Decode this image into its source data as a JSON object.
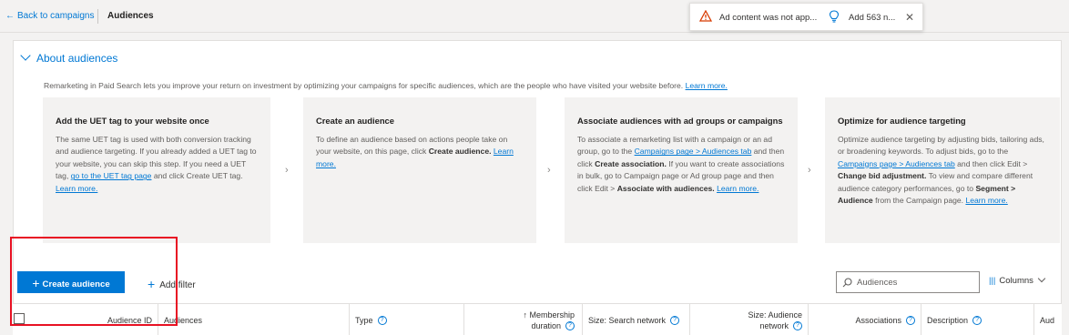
{
  "topbar": {
    "back_label": "Back to campaigns",
    "title": "Audiences"
  },
  "notifications": {
    "warning_text": "Ad content was not app...",
    "tip_text": "Add 563 n...",
    "warning_icon": "warning-triangle-icon",
    "tip_icon": "lightbulb-icon",
    "close_icon": "close-icon"
  },
  "about": {
    "toggle_label": "About audiences",
    "intro_text": "Remarketing in Paid Search lets you improve your return on investment by optimizing your campaigns for specific audiences, which are the people who have visited your website before.",
    "intro_link": "Learn more.",
    "cards": [
      {
        "title": "Add the UET tag to your website once",
        "text1": "The same UET tag is used with both conversion tracking and audience targeting. If you already added a UET tag to your website, you can skip this step. If you need a UET tag,",
        "link1": "go to the UET tag page",
        "text2": "and click Create UET tag.",
        "link2": "Learn more."
      },
      {
        "title": "Create an audience",
        "text1": "To define an audience based on actions people take on your website, on this page, click",
        "bold1": "Create audience.",
        "link1": "Learn more."
      },
      {
        "title": "Associate audiences with ad groups or campaigns",
        "text1": "To associate a remarketing list with a campaign or an ad group, go to the",
        "link1": "Campaigns page > Audiences tab",
        "text2": "and then click",
        "bold1": "Create association.",
        "text3": "If you want to create associations in bulk, go to Campaign page or Ad group page and then click Edit >",
        "bold2": "Associate with audiences.",
        "link2": "Learn more."
      },
      {
        "title": "Optimize for audience targeting",
        "text1": "Optimize audience targeting by adjusting bids, tailoring ads, or broadening keywords. To adjust bids, go to the",
        "link1": "Campaigns page > Audiences tab",
        "text2": "and then click Edit >",
        "bold1": "Change bid adjustment.",
        "text3": "To view and compare different audience category performances, go to",
        "bold2": "Segment > Audience",
        "text4": "from the Campaign page.",
        "link2": "Learn more."
      }
    ]
  },
  "toolbar": {
    "create_label": "Create audience",
    "add_filter_label": "Add filter",
    "search_placeholder": "Audiences",
    "columns_label": "Columns"
  },
  "table": {
    "headers": {
      "audience_id": "Audience ID",
      "audiences": "Audiences",
      "type": "Type",
      "membership_line1": "Membership",
      "membership_line2": "duration",
      "size_search": "Size: Search network",
      "size_audience_line1": "Size: Audience",
      "size_audience_line2": "network",
      "associations": "Associations",
      "description": "Description",
      "aud": "Aud"
    }
  },
  "colors": {
    "accent": "#0078d4",
    "highlight_box": "#e81123",
    "warning": "#d83b01"
  }
}
